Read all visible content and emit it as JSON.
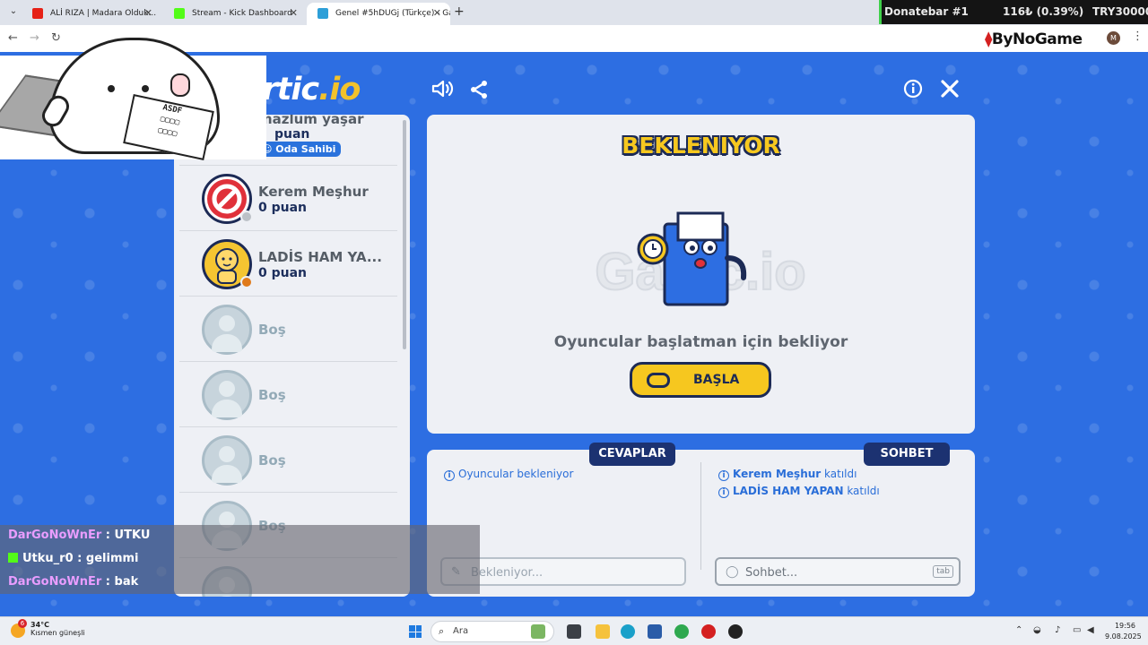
{
  "browser": {
    "tabs": [
      {
        "title": "ALİ RIZA | Madara Olduk...",
        "favicon_color": "#e62117"
      },
      {
        "title": "Stream - Kick Dashboard",
        "favicon_color": "#53fc18"
      },
      {
        "title": "Genel #5hDUGj (Türkçe) - Gartic",
        "favicon_color": "#2d9fd8"
      }
    ],
    "new_tab_label": "+",
    "profile_initial": "M",
    "extension_brand": "ByNoGame"
  },
  "stream_overlay": {
    "donate_title": "Donatebar #1",
    "donate_amount": "116₺ (0.39%)",
    "donate_goal": "TRY30000"
  },
  "game": {
    "logo_main": "Gartic",
    "logo_suffix": ".io",
    "players": [
      {
        "name": "mazlum yaşar",
        "score": "puan",
        "badge": "Oda Sahibi",
        "status_color": "#f2c22b"
      },
      {
        "name": "Kerem Meşhur",
        "score": "0 puan",
        "status_color": "#bcc1c7"
      },
      {
        "name": "LADİS HAM YA...",
        "score": "0 puan",
        "status_color": "#e07a1a"
      },
      {
        "name": "Boş"
      },
      {
        "name": "Boş"
      },
      {
        "name": "Boş"
      },
      {
        "name": "Boş"
      }
    ],
    "status_title": "BEKLENIYOR",
    "status_message": "Oyuncular başlatman için bekliyor",
    "start_button": "BAŞLA",
    "answers_tab": "CEVAPLAR",
    "chat_tab": "SOHBET",
    "answers_messages": [
      {
        "text": "Oyuncular bekleniyor"
      }
    ],
    "chat_messages": [
      {
        "user": "Kerem Meşhur",
        "action": "katıldı"
      },
      {
        "user": "LADİS HAM YAPAN",
        "action": "katıldı"
      }
    ],
    "answer_placeholder": "Bekleniyor...",
    "chat_placeholder": "Sohbet...",
    "chat_key_hint": "tab"
  },
  "stream_chat": [
    {
      "user": "DarGoNoWnEr",
      "message": "UTKU",
      "platform": ""
    },
    {
      "user": "Utku_r0",
      "message": "gelimmi",
      "platform": "kick"
    },
    {
      "user": "DarGoNoWnEr",
      "message": "bak",
      "platform": ""
    }
  ],
  "cat_overlay": {
    "keys_text": "ASDF"
  },
  "taskbar": {
    "weather_temp": "34°C",
    "weather_desc": "Kısmen güneşli",
    "weather_badge": "6",
    "search_placeholder": "Ara",
    "time": "19:56",
    "date": "9.08.2025"
  },
  "colors": {
    "game_bg": "#2d6ee2",
    "accent_yellow": "#f6c71f",
    "navy": "#1c3271",
    "link_blue": "#2a6ed8"
  }
}
